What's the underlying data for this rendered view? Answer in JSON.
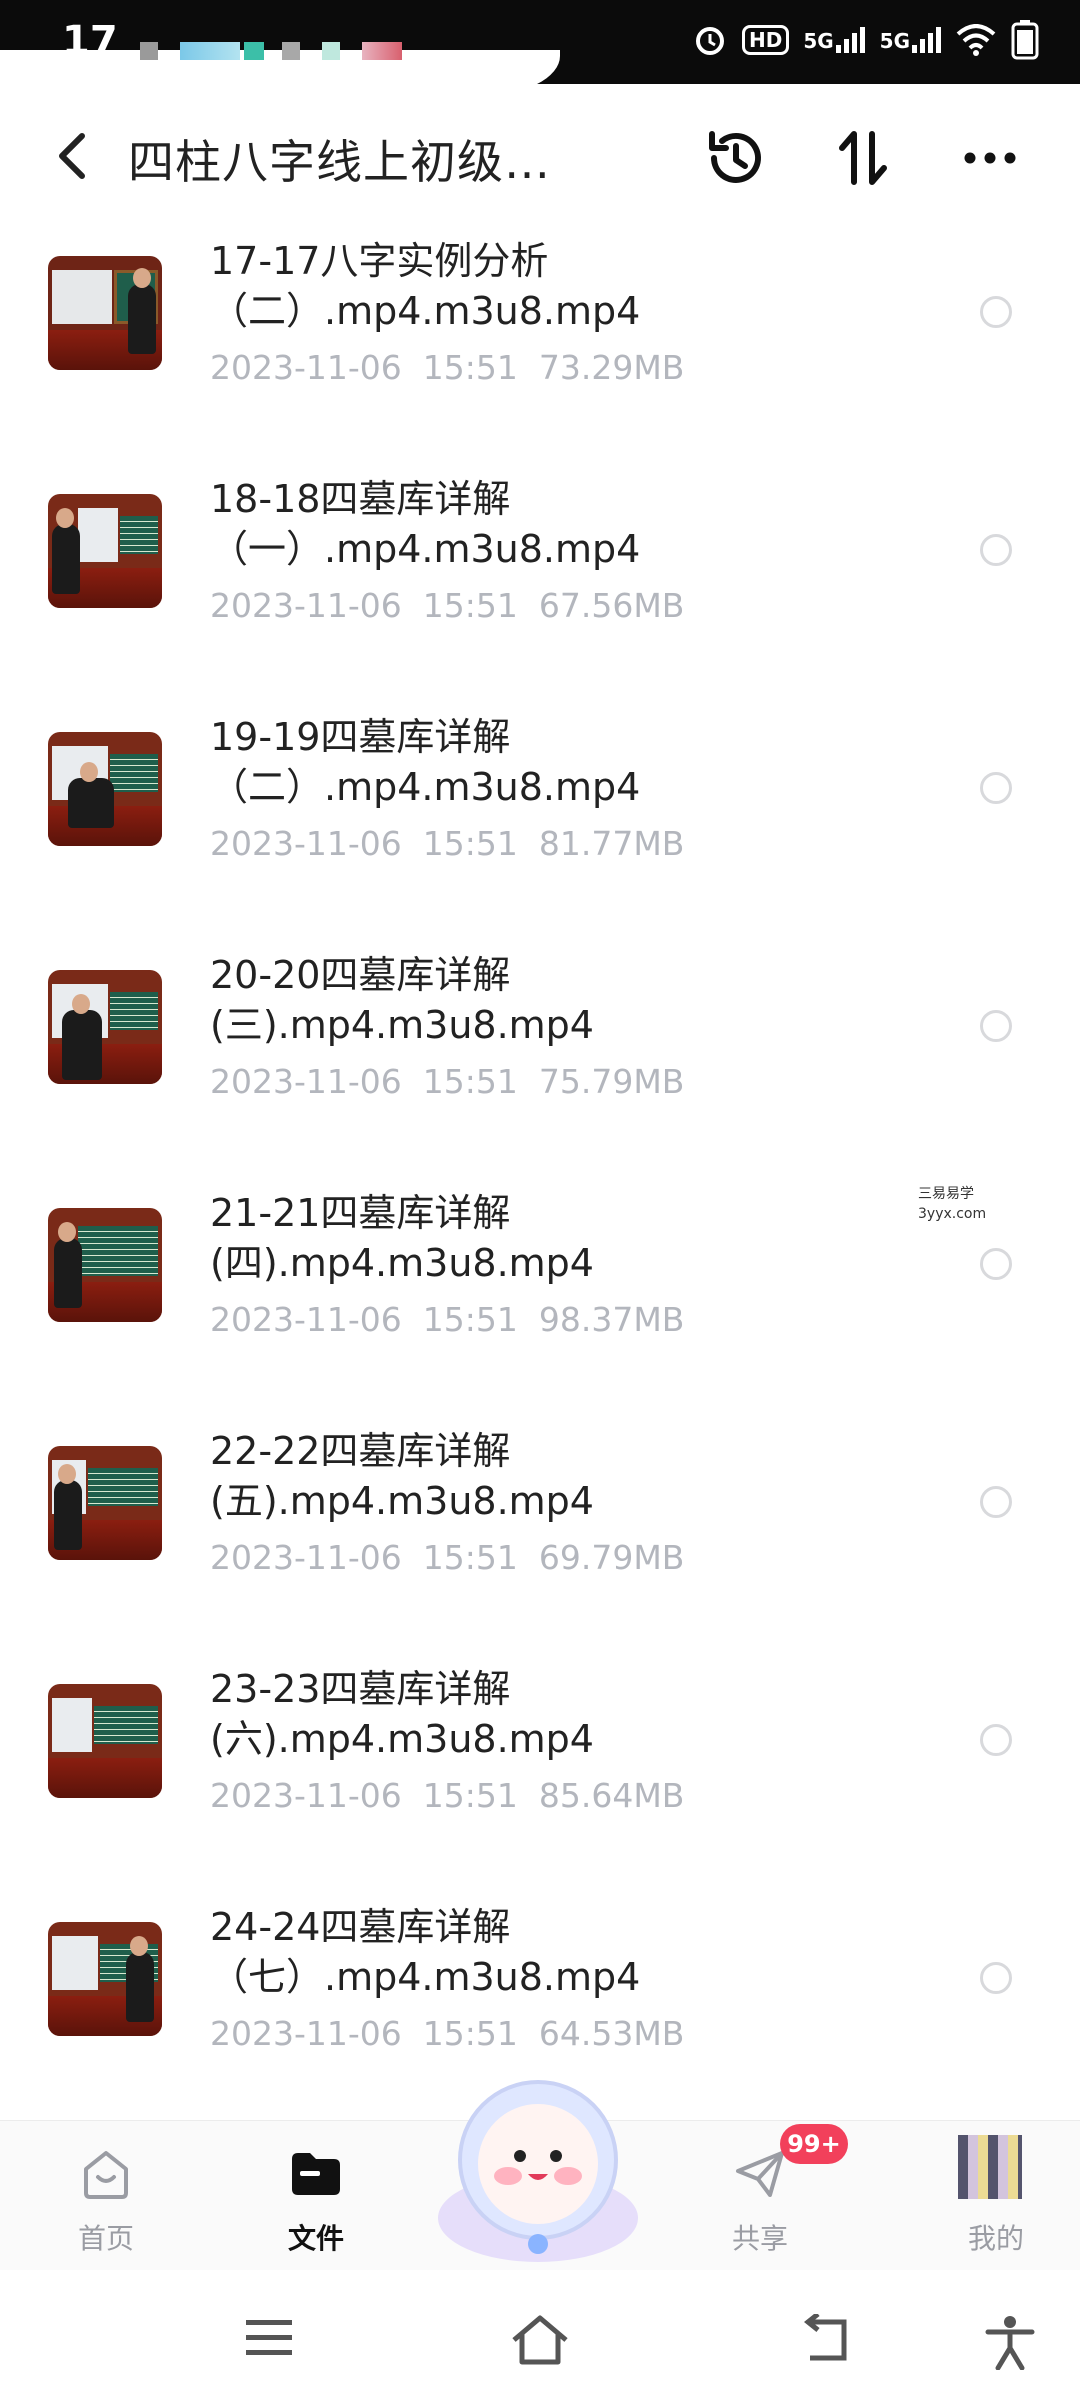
{
  "status_bar": {
    "time": "17",
    "icons": [
      "alarm-icon",
      "hd-icon",
      "5g-signal-icon",
      "5g-signal-icon",
      "wifi-icon",
      "battery-icon"
    ],
    "hd_label": "HD",
    "net_label_1": "5G",
    "net_label_2": "5G"
  },
  "header": {
    "title": "四柱八字线上初级…",
    "back_icon": "chevron-left-icon",
    "history_icon": "history-icon",
    "sort_icon": "sort-icon",
    "more_icon": "more-icon"
  },
  "files": [
    {
      "line1": "17-17八字实例分析",
      "line2": "（二）.mp4.m3u8.mp4",
      "date": "2023-11-06",
      "time": "15:51",
      "size": "73.29MB"
    },
    {
      "line1": "18-18四墓库详解",
      "line2": "（一）.mp4.m3u8.mp4",
      "date": "2023-11-06",
      "time": "15:51",
      "size": "67.56MB"
    },
    {
      "line1": "19-19四墓库详解",
      "line2": "（二）.mp4.m3u8.mp4",
      "date": "2023-11-06",
      "time": "15:51",
      "size": "81.77MB"
    },
    {
      "line1": "20-20四墓库详解",
      "line2": "(三).mp4.m3u8.mp4",
      "date": "2023-11-06",
      "time": "15:51",
      "size": "75.79MB"
    },
    {
      "line1": "21-21四墓库详解",
      "line2": "(四).mp4.m3u8.mp4",
      "date": "2023-11-06",
      "time": "15:51",
      "size": "98.37MB"
    },
    {
      "line1": "22-22四墓库详解",
      "line2": "(五).mp4.m3u8.mp4",
      "date": "2023-11-06",
      "time": "15:51",
      "size": "69.79MB"
    },
    {
      "line1": "23-23四墓库详解",
      "line2": "(六).mp4.m3u8.mp4",
      "date": "2023-11-06",
      "time": "15:51",
      "size": "85.64MB"
    },
    {
      "line1": "24-24四墓库详解",
      "line2": "（七）.mp4.m3u8.mp4",
      "date": "2023-11-06",
      "time": "15:51",
      "size": "64.53MB"
    }
  ],
  "watermark": {
    "line1": "三易易学",
    "line2": "3yyx.com"
  },
  "bottom_nav": {
    "home": "首页",
    "files": "文件",
    "share": "共享",
    "me": "我的",
    "share_badge": "99+"
  },
  "colors": {
    "accent": "#f2405b",
    "text": "#222222",
    "meta": "#b3b6bd"
  }
}
